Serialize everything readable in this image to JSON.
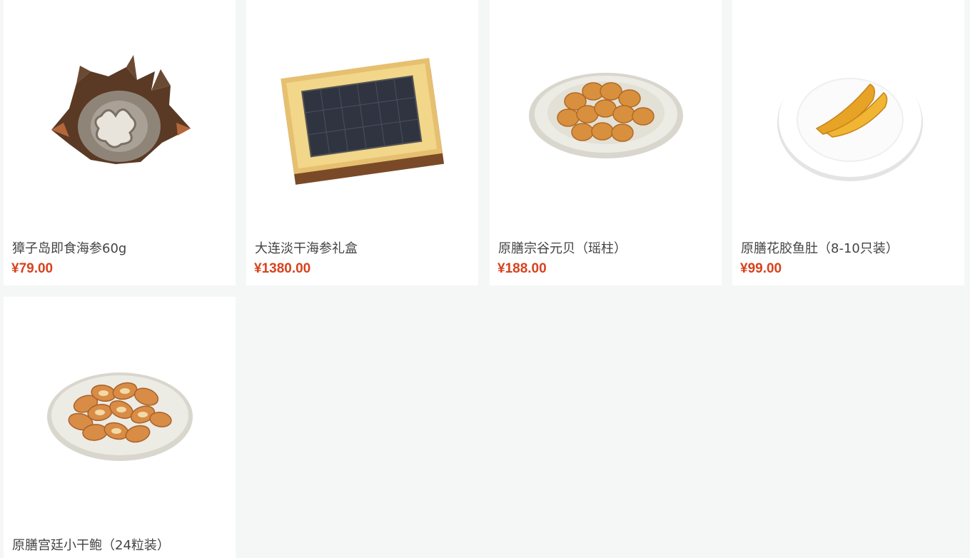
{
  "products": [
    {
      "name": "獐子岛即食海参60g",
      "price": "¥79.00",
      "icon": "sea-cucumber-image"
    },
    {
      "name": "大连淡干海参礼盒",
      "price": "¥1380.00",
      "icon": "gift-box-image"
    },
    {
      "name": "原膳宗谷元贝（瑶柱）",
      "price": "¥188.00",
      "icon": "scallops-plate-image"
    },
    {
      "name": "原膳花胶鱼肚（8-10只装）",
      "price": "¥99.00",
      "icon": "fish-maw-plate-image"
    },
    {
      "name": "原膳宫廷小干鲍（24粒装）",
      "price": "",
      "icon": "abalone-plate-image"
    }
  ],
  "colors": {
    "background": "#f5f7f7",
    "card": "#ffffff",
    "price": "#d8421e",
    "name": "#444444"
  }
}
